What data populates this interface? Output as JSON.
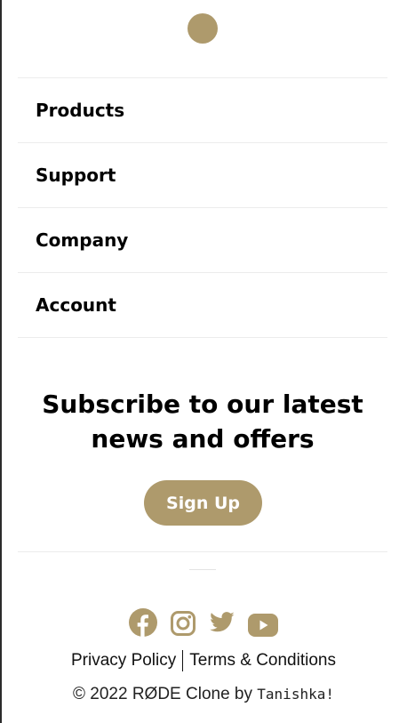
{
  "colors": {
    "accent": "#ae9a6c",
    "text": "#000000",
    "divider": "#ececec"
  },
  "logo": {
    "icon": "brand-dot-icon"
  },
  "nav": {
    "items": [
      {
        "label": "Products"
      },
      {
        "label": "Support"
      },
      {
        "label": "Company"
      },
      {
        "label": "Account"
      }
    ]
  },
  "subscribe": {
    "title_line1": "Subscribe to our latest",
    "title_line2": "news and offers",
    "button_label": "Sign Up"
  },
  "social": {
    "icons": [
      "facebook-icon",
      "instagram-icon",
      "twitter-icon",
      "youtube-icon"
    ]
  },
  "legal": {
    "privacy": "Privacy Policy",
    "terms": "Terms & Conditions"
  },
  "copyright": {
    "text": "© 2022 RØDE Clone by ",
    "author": "Tanishka!"
  }
}
